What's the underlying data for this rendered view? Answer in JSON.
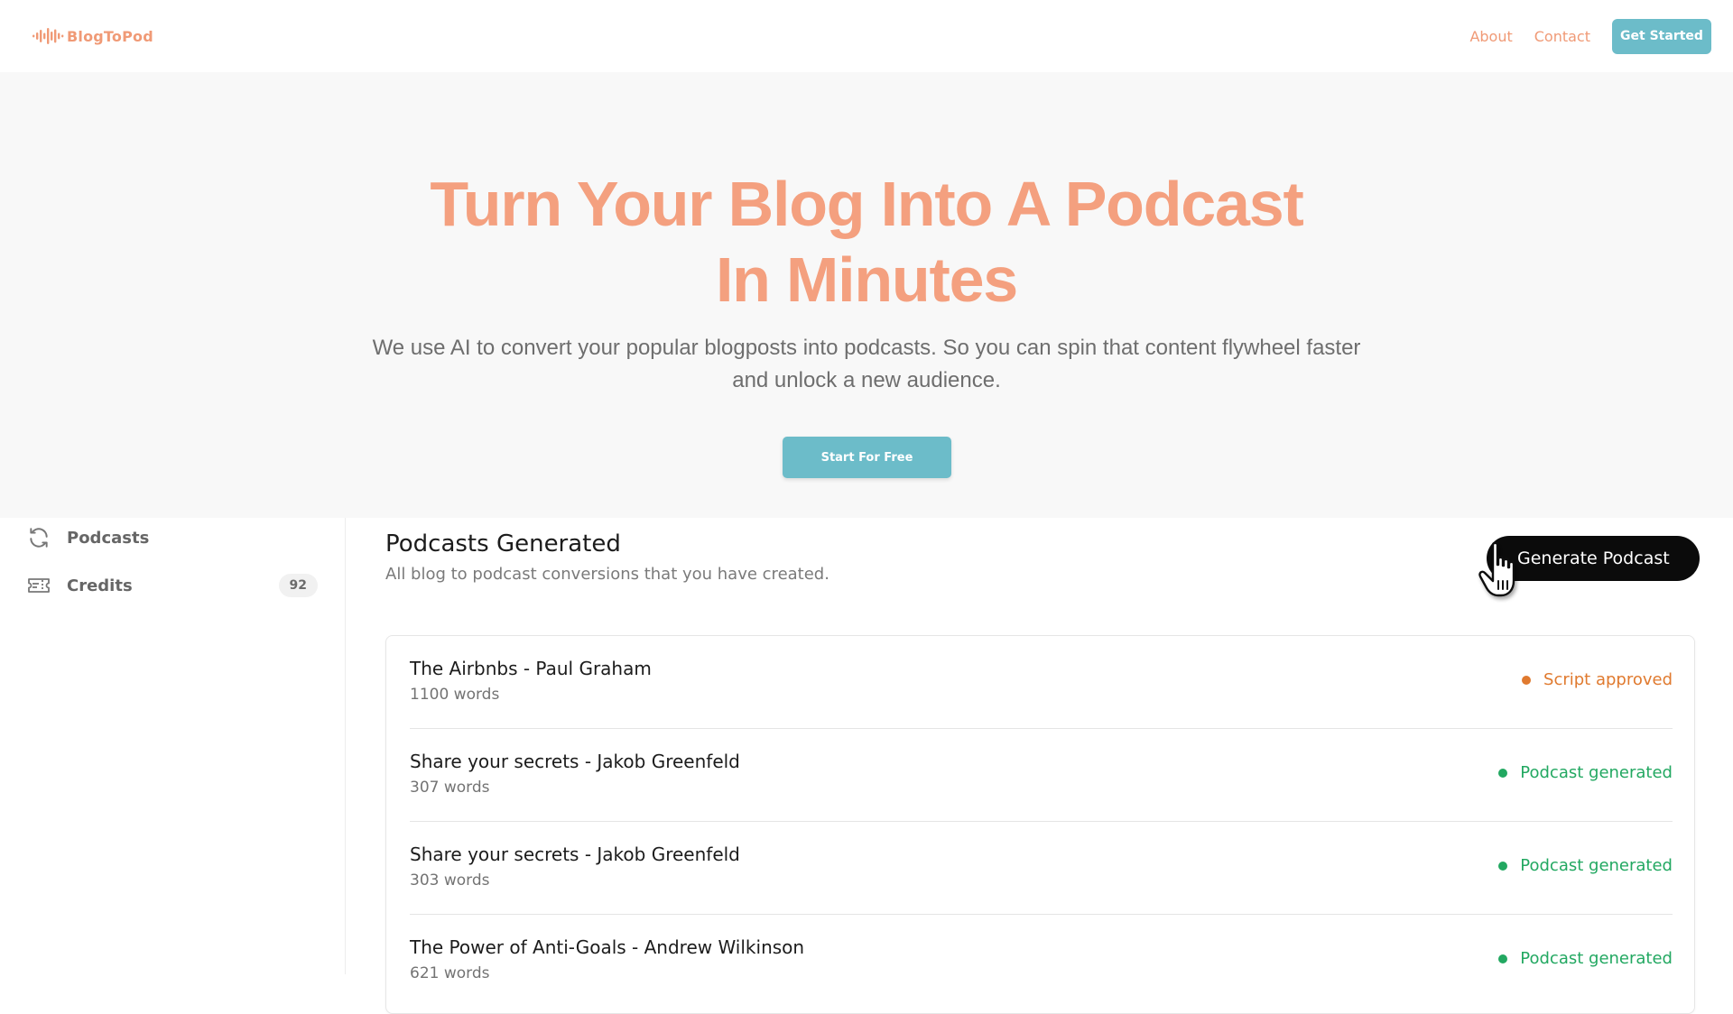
{
  "nav": {
    "logo_text": "BlogToPod",
    "links": [
      "About",
      "Contact"
    ],
    "cta_label": "Get Started"
  },
  "hero": {
    "title_line1": "Turn Your Blog Into A Podcast",
    "title_line2": "In Minutes",
    "subtitle": "We use AI to convert your popular blogposts into podcasts. So you can spin that content flywheel faster and unlock a new audience.",
    "cta_label": "Start For Free"
  },
  "sidebar": {
    "items": [
      {
        "label": "Podcasts",
        "icon": "refresh-icon"
      },
      {
        "label": "Credits",
        "icon": "ticket-icon",
        "badge": "92"
      }
    ]
  },
  "main": {
    "title": "Podcasts Generated",
    "subtitle": "All blog to podcast conversions that you have created.",
    "generate_label": "Generate Podcast",
    "rows": [
      {
        "title": "The Airbnbs - Paul Graham",
        "words": "1100 words",
        "status": "Script approved",
        "status_color": "#e07a2f"
      },
      {
        "title": "Share your secrets - Jakob Greenfeld",
        "words": "307 words",
        "status": "Podcast generated",
        "status_color": "#22a861"
      },
      {
        "title": "Share your secrets - Jakob Greenfeld",
        "words": "303 words",
        "status": "Podcast generated",
        "status_color": "#22a861"
      },
      {
        "title": "The Power of Anti-Goals - Andrew Wilkinson",
        "words": "621 words",
        "status": "Podcast generated",
        "status_color": "#22a861"
      }
    ]
  },
  "colors": {
    "brand_orange": "#f4a07f",
    "brand_teal": "#6cbcc9"
  }
}
